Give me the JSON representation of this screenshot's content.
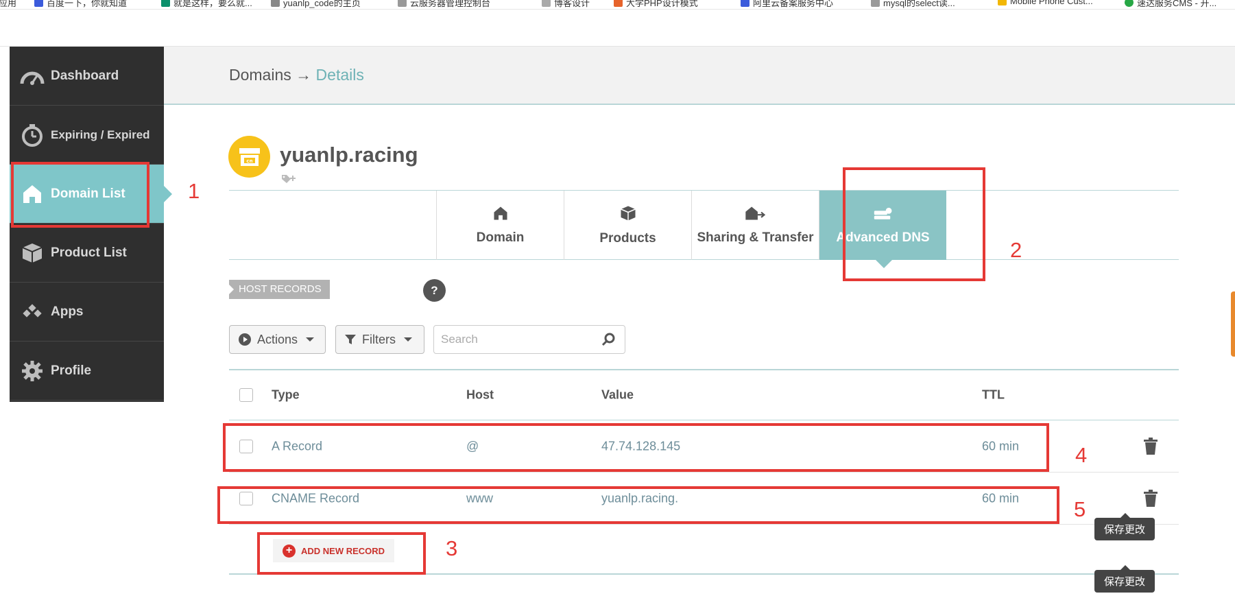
{
  "browser": {
    "bookmarks": [
      "应用",
      "百度一下，你就知道",
      "就是这样，要么就...",
      "yuanlp_code的主页",
      "云服务器管理控制台",
      "博客设计",
      "大学PHP设计模式",
      "阿里云备案服务中心",
      "mysql的select读...",
      "Mobile Phone Cust...",
      "速达服务CMS - 开..."
    ]
  },
  "sidebar": {
    "items": [
      {
        "label": "Dashboard",
        "icon": "speedometer-icon"
      },
      {
        "label": "Expiring / Expired",
        "icon": "stopwatch-icon"
      },
      {
        "label": "Domain List",
        "icon": "home-icon"
      },
      {
        "label": "Product List",
        "icon": "box-icon"
      },
      {
        "label": "Apps",
        "icon": "apps-icon"
      },
      {
        "label": "Profile",
        "icon": "gear-icon"
      }
    ],
    "active_index": 2
  },
  "header": {
    "breadcrumb_root": "Domains",
    "breadcrumb_sep": "→",
    "breadcrumb_current": "Details"
  },
  "domain": {
    "name": "yuanlp.racing"
  },
  "tabs": [
    {
      "label": "Domain",
      "icon": "home-icon"
    },
    {
      "label": "Products",
      "icon": "box-icon"
    },
    {
      "label": "Sharing & Transfer",
      "icon": "share-home-icon"
    },
    {
      "label": "Advanced DNS",
      "icon": "dns-server-icon",
      "active": true
    }
  ],
  "host_records": {
    "label": "HOST RECORDS",
    "help": "?"
  },
  "toolbar": {
    "actions_label": "Actions",
    "filters_label": "Filters",
    "search_placeholder": "Search"
  },
  "table": {
    "columns": [
      "Type",
      "Host",
      "Value",
      "TTL"
    ],
    "rows": [
      {
        "type": "A Record",
        "host": "@",
        "value": "47.74.128.145",
        "ttl": "60 min"
      },
      {
        "type": "CNAME Record",
        "host": "www",
        "value": "yuanlp.racing.",
        "ttl": "60 min"
      }
    ]
  },
  "add_record_label": "ADD NEW RECORD",
  "tooltips": [
    "保存更改",
    "保存更改"
  ],
  "annotations": [
    "1",
    "2",
    "3",
    "4",
    "5"
  ],
  "colors": {
    "sidebar_bg": "#2f2f2f",
    "accent_teal": "#7fc6c9",
    "domain_logo": "#f7c21a",
    "annotation_red": "#e53935",
    "add_red": "#d9322d"
  }
}
